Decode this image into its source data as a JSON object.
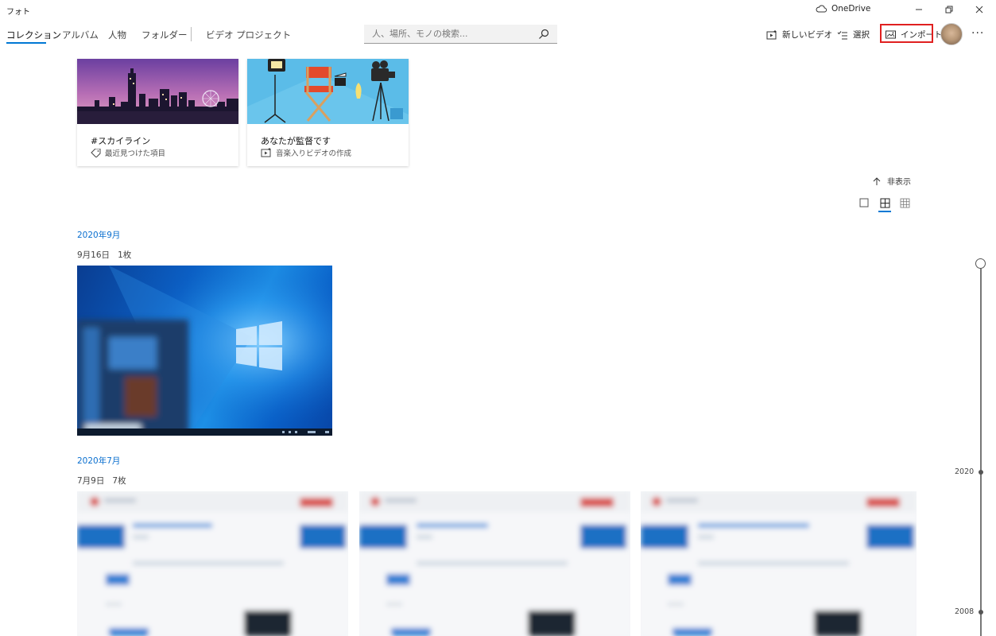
{
  "app": {
    "title": "フォト"
  },
  "titlebar": {
    "onedrive_label": "OneDrive"
  },
  "nav": {
    "items": [
      {
        "label": "コレクション",
        "active": true
      },
      {
        "label": "アルバム",
        "active": false
      },
      {
        "label": "人物",
        "active": false
      },
      {
        "label": "フォルダー",
        "active": false
      },
      {
        "label": "ビデオ プロジェクト",
        "active": false
      }
    ]
  },
  "search": {
    "placeholder": "人、場所、モノの検索..."
  },
  "toolbar": {
    "new_video": "新しいビデオ",
    "select": "選択",
    "import": "インポート",
    "more": "···"
  },
  "cards": [
    {
      "title": "#スカイライン",
      "subtitle": "最近見つけた項目",
      "icon": "tag-icon"
    },
    {
      "title": "あなたが監督です",
      "subtitle": "音楽入りビデオの作成",
      "icon": "video-icon"
    }
  ],
  "hide_label": "非表示",
  "groups": [
    {
      "month": "2020年9月",
      "day": "9月16日",
      "count": "1枚"
    },
    {
      "month": "2020年7月",
      "day": "7月9日",
      "count": "7枚"
    }
  ],
  "timeline": {
    "labels": [
      "2020",
      "2008"
    ]
  },
  "colors": {
    "accent": "#0078d4",
    "link": "#0a6fcf",
    "highlight_box": "#e02020"
  }
}
